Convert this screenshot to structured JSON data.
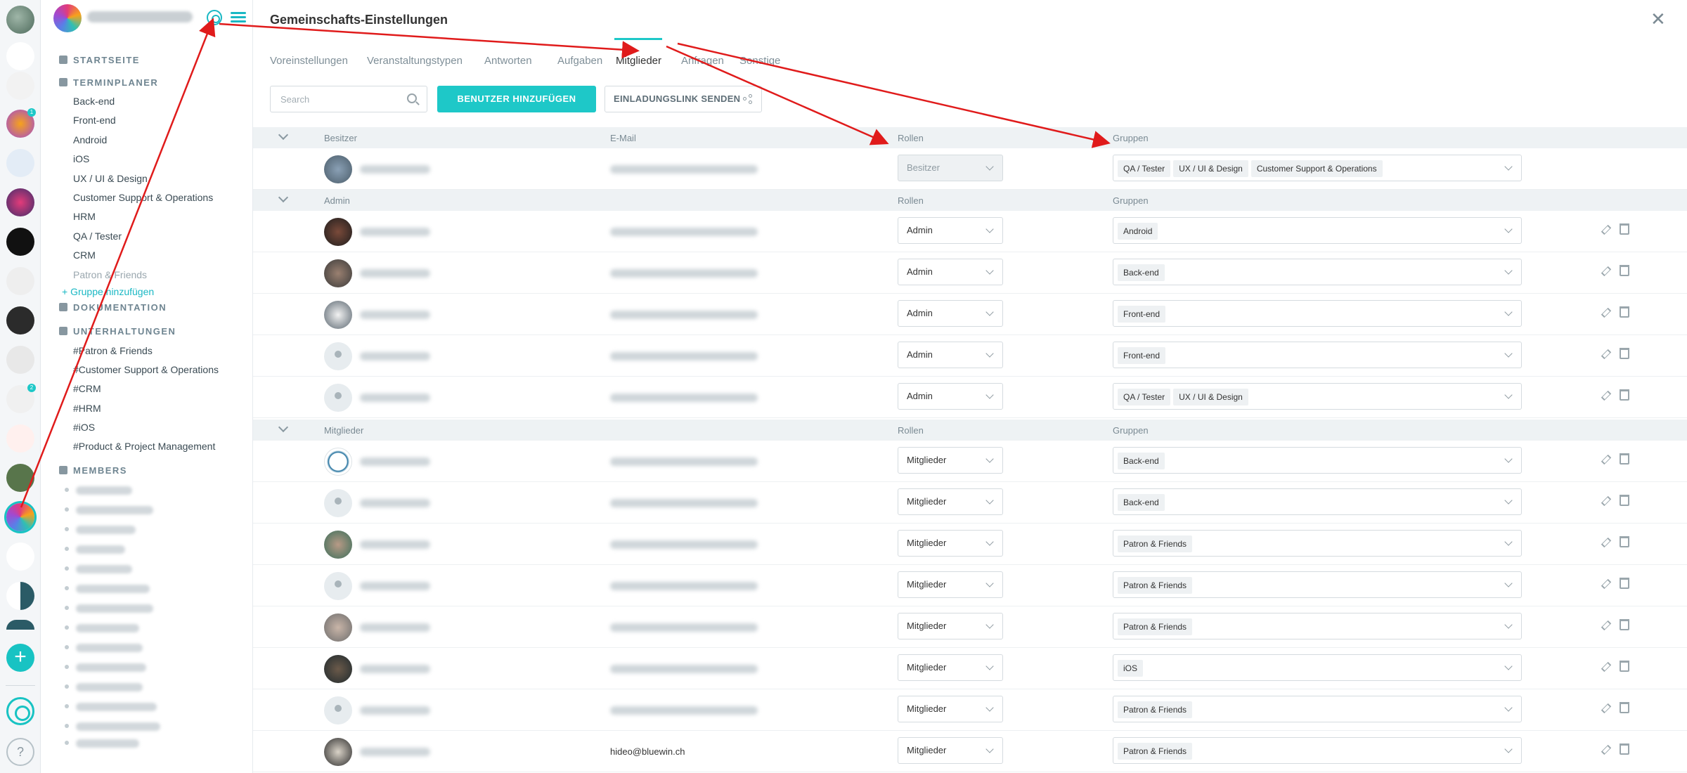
{
  "page_title": "Gemeinschafts-Einstellungen",
  "tabs": [
    {
      "label": "Voreinstellungen"
    },
    {
      "label": "Veranstaltungstypen"
    },
    {
      "label": "Antworten"
    },
    {
      "label": "Aufgaben"
    },
    {
      "label": "Mitglieder"
    },
    {
      "label": "Anfragen"
    },
    {
      "label": "Sonstige"
    }
  ],
  "toolbar": {
    "search_placeholder": "Search",
    "add_user_label": "BENUTZER HINZUFÜGEN",
    "invite_label": "EINLADUNGSLINK SENDEN"
  },
  "sidebar": {
    "home": "STARTSEITE",
    "planner": "TERMINPLANER",
    "planner_items": [
      "Back-end",
      "Front-end",
      "Android",
      "iOS",
      "UX / UI & Design",
      "Customer Support & Operations",
      "HRM",
      "QA / Tester",
      "CRM",
      "Patron & Friends"
    ],
    "add_group": "+ Gruppe hinzufügen",
    "docs": "DOKUMENTATION",
    "conversations": "UNTERHALTUNGEN",
    "conversation_items": [
      "#Patron & Friends",
      "#Customer Support & Operations",
      "#CRM",
      "#HRM",
      "#iOS",
      "#Product & Project Management"
    ],
    "members": "MEMBERS"
  },
  "rail": {
    "badges": [
      "1",
      "2"
    ],
    "add_label": "+",
    "help_label": "?"
  },
  "columns": {
    "name_owner": "Besitzer",
    "name_admin": "Admin",
    "name_member": "Mitglieder",
    "email": "E-Mail",
    "roles": "Rollen",
    "groups": "Gruppen"
  },
  "owner_rows": [
    {
      "role": "Besitzer",
      "groups": [
        "QA / Tester",
        "UX / UI & Design",
        "Customer Support & Operations"
      ]
    }
  ],
  "admin_rows": [
    {
      "role": "Admin",
      "groups": [
        "Android"
      ]
    },
    {
      "role": "Admin",
      "groups": [
        "Back-end"
      ]
    },
    {
      "role": "Admin",
      "groups": [
        "Front-end"
      ]
    },
    {
      "role": "Admin",
      "groups": [
        "Front-end"
      ]
    },
    {
      "role": "Admin",
      "groups": [
        "QA / Tester",
        "UX / UI & Design"
      ]
    }
  ],
  "member_rows": [
    {
      "role": "Mitglieder",
      "groups": [
        "Back-end"
      ]
    },
    {
      "role": "Mitglieder",
      "groups": [
        "Back-end"
      ]
    },
    {
      "role": "Mitglieder",
      "groups": [
        "Patron & Friends"
      ]
    },
    {
      "role": "Mitglieder",
      "groups": [
        "Patron & Friends"
      ]
    },
    {
      "role": "Mitglieder",
      "groups": [
        "Patron & Friends"
      ]
    },
    {
      "role": "Mitglieder",
      "groups": [
        "iOS"
      ]
    },
    {
      "role": "Mitglieder",
      "groups": [
        "Patron & Friends"
      ]
    },
    {
      "role": "Mitglieder",
      "groups": [
        "Patron & Friends"
      ],
      "email_visible": "hideo@bluewin.ch"
    }
  ],
  "colors": {
    "accent": "#1ec8c8",
    "annotation_arrow": "#e01b1b"
  }
}
